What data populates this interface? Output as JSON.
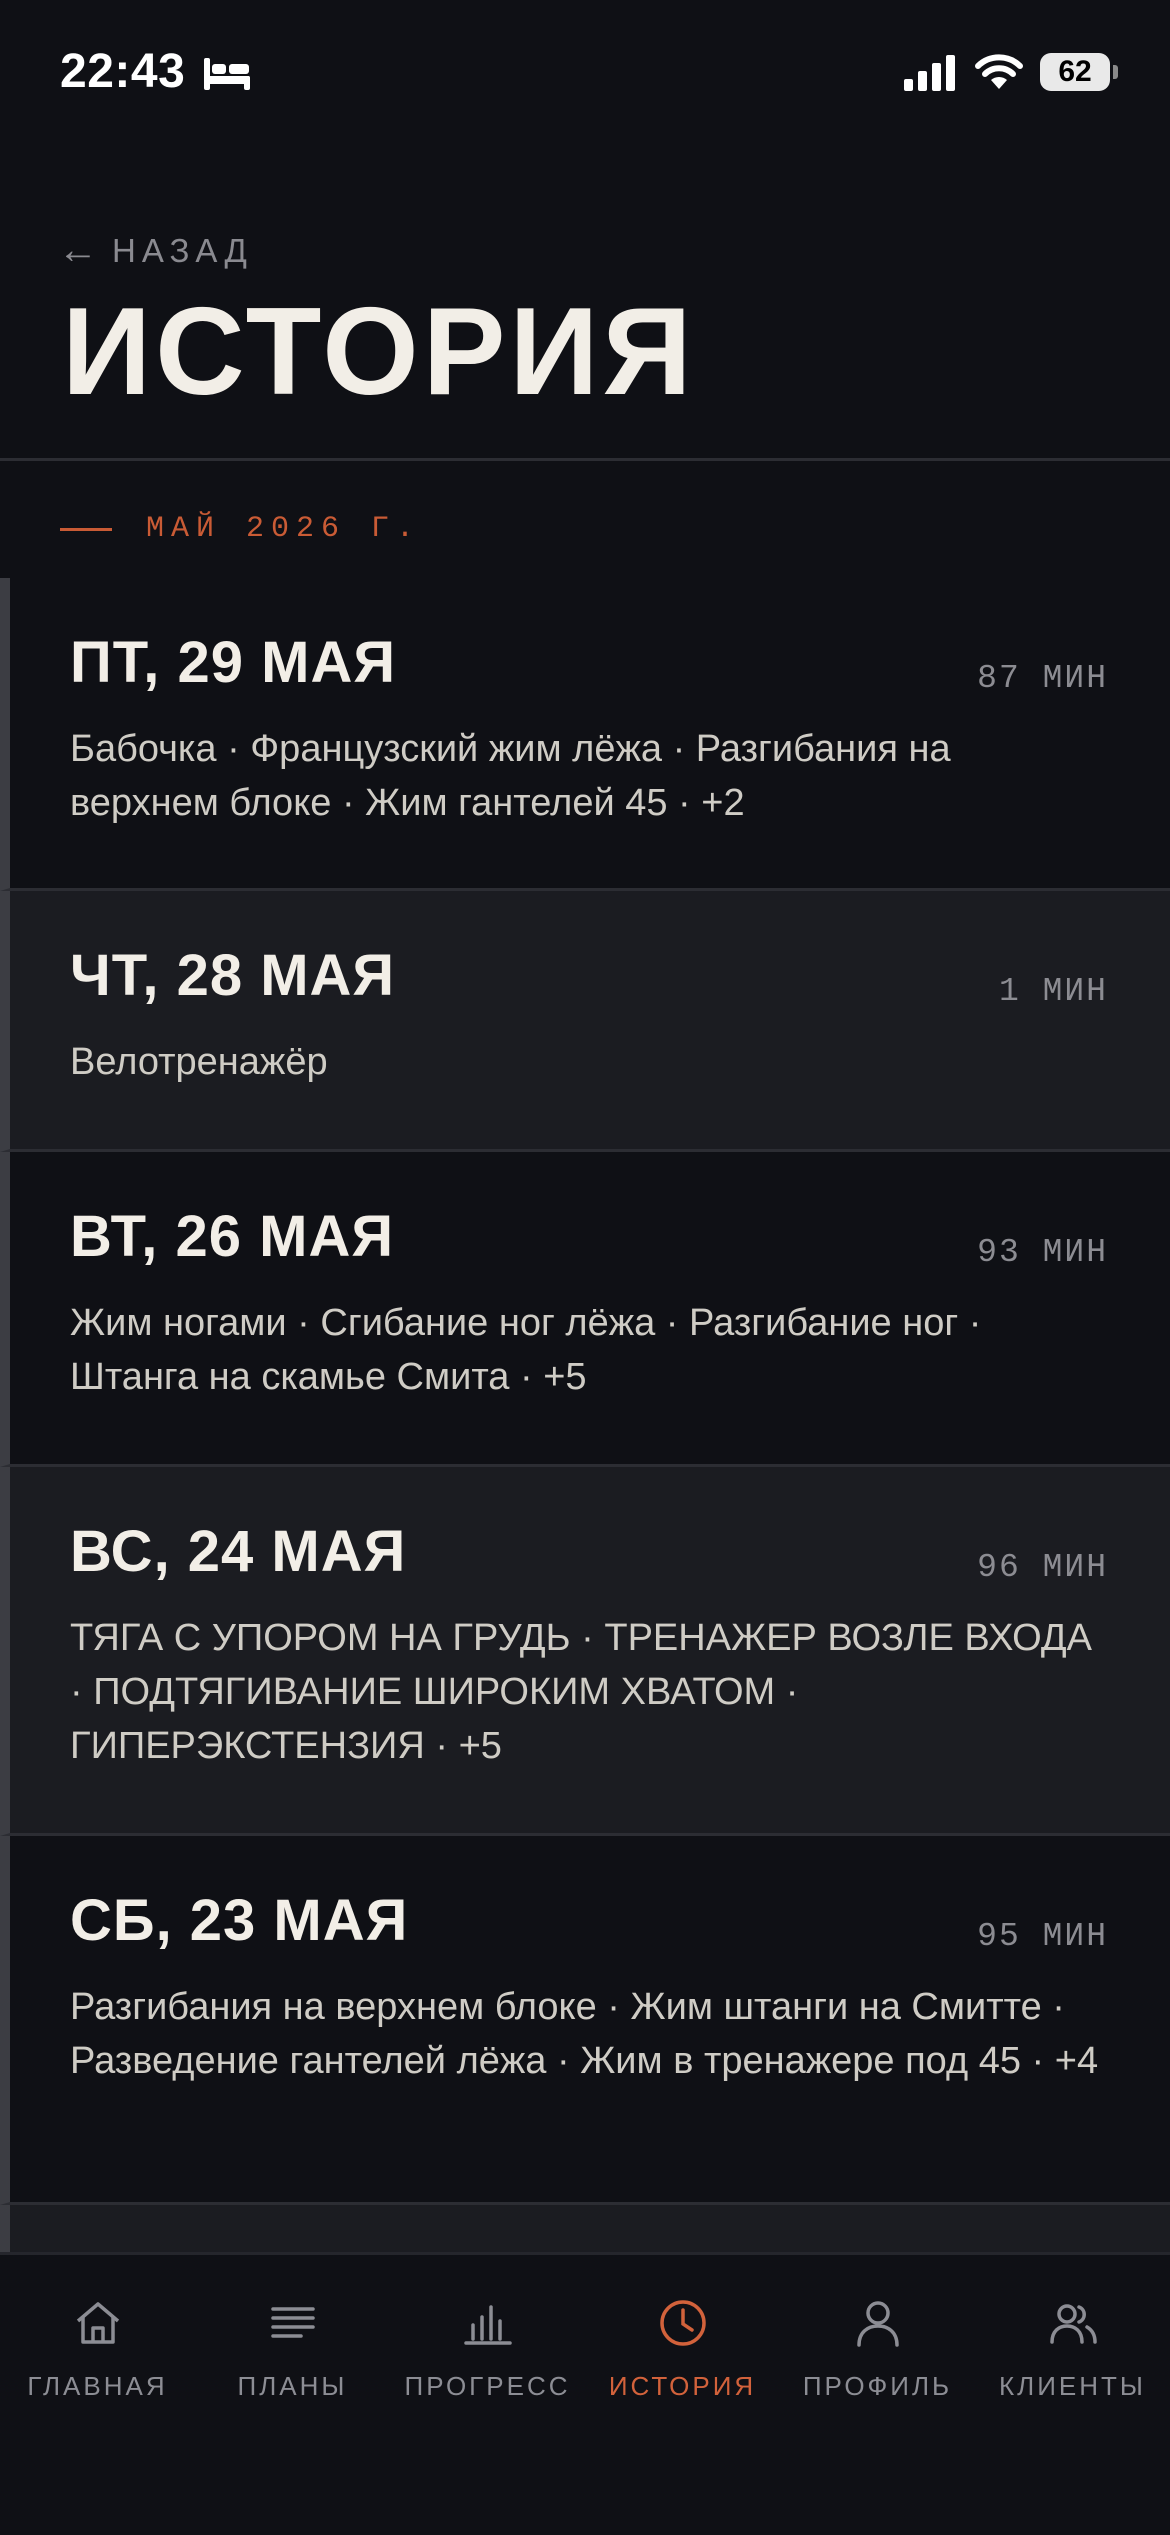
{
  "status_bar": {
    "time": "22:43",
    "battery": "62"
  },
  "header": {
    "back_label": "НАЗАД",
    "title": "ИСТОРИЯ"
  },
  "month": "МАЙ 2026 Г.",
  "sessions": [
    {
      "date": "ПТ, 29 МАЯ",
      "duration": "87 МИН",
      "exercises": "Бабочка · Французский жим лёжа · Разгибания на верхнем блоке · Жим гантелей 45 · +2"
    },
    {
      "date": "ЧТ, 28 МАЯ",
      "duration": "1 МИН",
      "exercises": "Велотренажёр"
    },
    {
      "date": "ВТ, 26 МАЯ",
      "duration": "93 МИН",
      "exercises": "Жим ногами · Сгибание ног лёжа · Разгибание ног · Штанга на скамье Смита · +5"
    },
    {
      "date": "ВС, 24 МАЯ",
      "duration": "96 МИН",
      "exercises": "ТЯГА С УПОРОМ НА ГРУДЬ · ТРЕНАЖЕР ВОЗЛЕ ВХОДА · ПОДТЯГИВАНИЕ ШИРОКИМ ХВАТОМ · ГИПЕРЭКСТЕНЗИЯ · +5"
    },
    {
      "date": "СБ, 23 МАЯ",
      "duration": "95 МИН",
      "exercises": "Разгибания на верхнем блоке · Жим штанги на Смитте · Разведение гантелей лёжа · Жим в тренажере под 45 · +4"
    }
  ],
  "nav": [
    {
      "label": "ГЛАВНАЯ",
      "icon": "home-icon"
    },
    {
      "label": "ПЛАНЫ",
      "icon": "list-icon"
    },
    {
      "label": "ПРОГРЕСС",
      "icon": "bar-chart-icon"
    },
    {
      "label": "ИСТОРИЯ",
      "icon": "clock-icon",
      "active": true
    },
    {
      "label": "ПРОФИЛЬ",
      "icon": "user-icon"
    },
    {
      "label": "КЛИЕНТЫ",
      "icon": "users-icon"
    }
  ],
  "colors": {
    "accent": "#d2623b",
    "background": "#0f1015",
    "card_alt": "#1b1c21",
    "text": "#f2eee7",
    "muted": "#8c8d94"
  }
}
